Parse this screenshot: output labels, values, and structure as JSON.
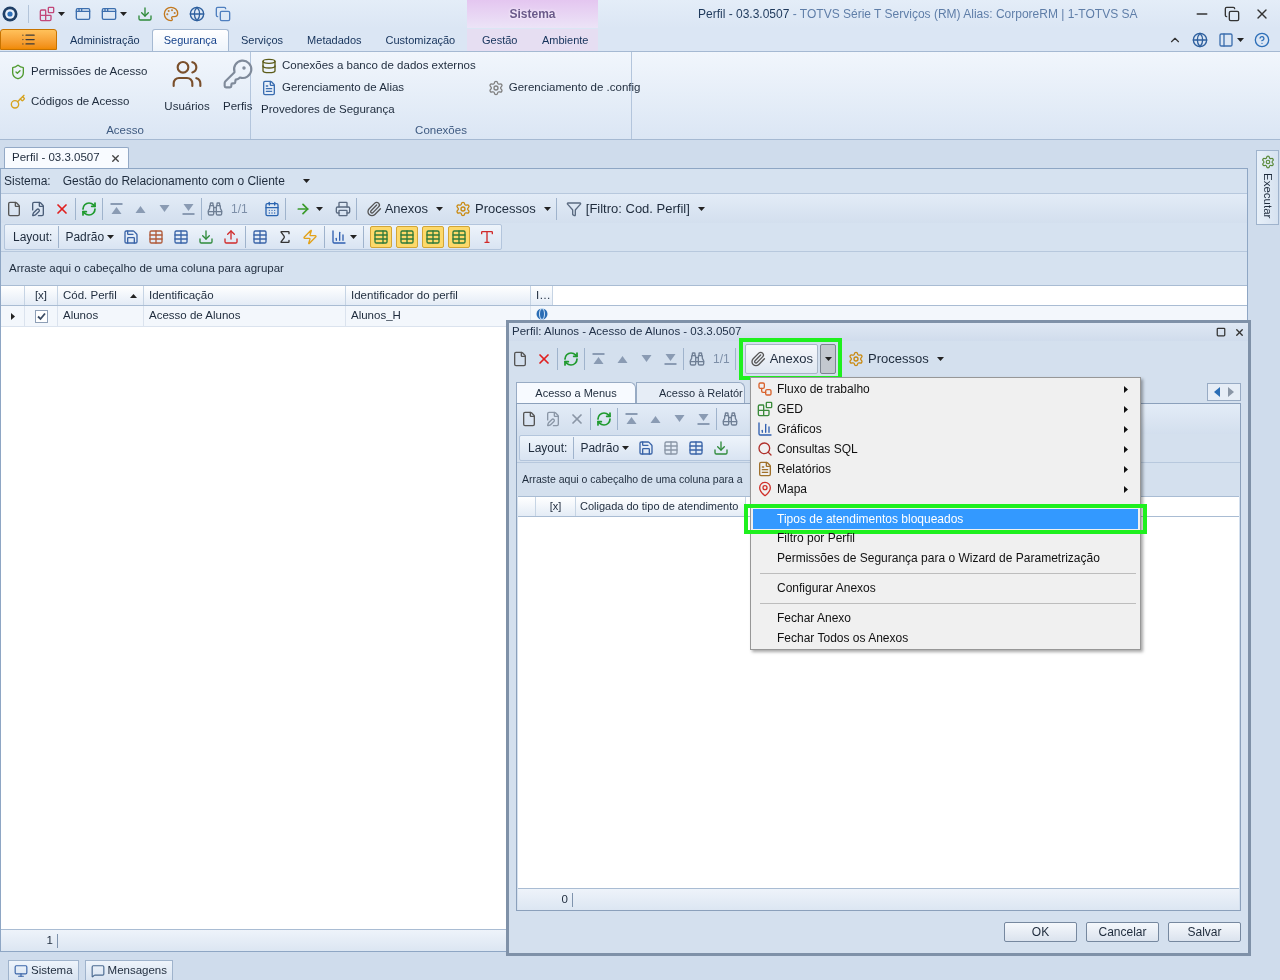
{
  "title_bar": {
    "context_group": "Sistema",
    "document": "Perfil - 03.3.0507",
    "application": "- TOTVS Série T Serviços (RM) Alias: CorporeRM | 1-TOTVS SA"
  },
  "ribbon": {
    "tabs": [
      {
        "label": "Administração",
        "selected": false
      },
      {
        "label": "Segurança",
        "selected": true
      },
      {
        "label": "Serviços",
        "selected": false
      },
      {
        "label": "Metadados",
        "selected": false
      },
      {
        "label": "Customização",
        "selected": false
      }
    ],
    "context_tabs": [
      {
        "label": "Gestão",
        "selected": false
      },
      {
        "label": "Ambiente",
        "selected": false
      }
    ],
    "groups": [
      {
        "label": "Acesso",
        "items": [
          {
            "kind": "small",
            "label": "Permissões de Acesso"
          },
          {
            "kind": "small",
            "label": "Códigos de Acesso"
          },
          {
            "kind": "large",
            "label": "Usuários"
          },
          {
            "kind": "large",
            "label": "Perfis"
          }
        ]
      },
      {
        "label": "Conexões",
        "items": [
          {
            "kind": "small",
            "label": "Conexões a banco de dados externos"
          },
          {
            "kind": "small",
            "label": "Gerenciamento de Alias"
          },
          {
            "kind": "text",
            "label": "Provedores de Segurança"
          },
          {
            "kind": "small",
            "label": "Gerenciamento de .config"
          }
        ]
      }
    ]
  },
  "document_tabs": [
    {
      "label": "Perfil - 03.3.0507",
      "selected": true
    }
  ],
  "side_panel": {
    "label": "Executar"
  },
  "main": {
    "system": {
      "label": "Sistema:",
      "value": "Gestão do Relacionamento com o Cliente"
    },
    "toolbar": {
      "record_counter": "1/1",
      "attachments": "Anexos",
      "processes": "Processos",
      "filter": "[Filtro: Cod. Perfil]"
    },
    "layout_bar": {
      "label": "Layout:",
      "preset": "Padrão",
      "view_toggles": [
        {
          "on": true
        },
        {
          "on": true
        },
        {
          "on": true
        },
        {
          "on": true
        }
      ]
    },
    "group_hint": "Arraste aqui o cabeçalho de uma coluna para agrupar",
    "grid": {
      "check_column": "[x]",
      "columns": [
        {
          "label": "Cód. Perfil",
          "sorted_ascending": true
        },
        {
          "label": "Identificação",
          "sorted_ascending": false
        },
        {
          "label": "Identificador do perfil",
          "sorted_ascending": false
        },
        {
          "label": "I…",
          "sorted_ascending": false
        }
      ],
      "rows": [
        {
          "current": true,
          "checked": true,
          "cells": [
            "Alunos",
            "Acesso de Alunos",
            "Alunos_H"
          ]
        }
      ]
    },
    "footer_count": "1"
  },
  "dialog": {
    "title": "Perfil: Alunos - Acesso de Alunos - 03.3.0507",
    "toolbar": {
      "record_counter": "1/1",
      "attachments": {
        "label": "Anexos",
        "open": true,
        "annotated": true,
        "menu": [
          {
            "kind": "item",
            "label": "Fluxo de trabalho",
            "submenu": true,
            "selected": false,
            "annotated": false
          },
          {
            "kind": "item",
            "label": "GED",
            "submenu": true,
            "selected": false,
            "annotated": false
          },
          {
            "kind": "item",
            "label": "Gráficos",
            "submenu": true,
            "selected": false,
            "annotated": false
          },
          {
            "kind": "item",
            "label": "Consultas SQL",
            "submenu": true,
            "selected": false,
            "annotated": false
          },
          {
            "kind": "item",
            "label": "Relatórios",
            "submenu": true,
            "selected": false,
            "annotated": false
          },
          {
            "kind": "item",
            "label": "Mapa",
            "submenu": true,
            "selected": false,
            "annotated": false
          },
          {
            "kind": "item",
            "label": "Tipos de atendimentos bloqueados",
            "submenu": false,
            "selected": true,
            "annotated": true
          },
          {
            "kind": "item",
            "label": "Filtro por Perfil",
            "submenu": false,
            "selected": false,
            "annotated": false
          },
          {
            "kind": "item",
            "label": "Permissões de Segurança para o Wizard de Parametrização",
            "submenu": false,
            "selected": false,
            "annotated": false
          },
          {
            "kind": "separator"
          },
          {
            "kind": "item",
            "label": "Configurar Anexos",
            "submenu": false,
            "selected": false,
            "annotated": false
          },
          {
            "kind": "separator"
          },
          {
            "kind": "item",
            "label": "Fechar Anexo",
            "submenu": false,
            "selected": false,
            "annotated": false
          },
          {
            "kind": "item",
            "label": "Fechar Todos os Anexos",
            "submenu": false,
            "selected": false,
            "annotated": false
          }
        ]
      },
      "processes": "Processos"
    },
    "tabs": [
      {
        "label": "Acesso a Menus",
        "selected": true
      },
      {
        "label": "Acesso à Relatór",
        "selected": false
      }
    ],
    "layout_bar": {
      "label": "Layout:",
      "preset": "Padrão"
    },
    "group_hint": "Arraste aqui o cabeçalho de uma coluna para a",
    "grid": {
      "check_column": "[x]",
      "columns": [
        {
          "label": "Coligada do tipo de atendimento"
        }
      ]
    },
    "footer_count": "0",
    "buttons": [
      {
        "label": "OK"
      },
      {
        "label": "Cancelar"
      },
      {
        "label": "Salvar"
      }
    ]
  },
  "bottom_tabs": [
    {
      "label": "Sistema"
    },
    {
      "label": "Mensagens"
    }
  ]
}
